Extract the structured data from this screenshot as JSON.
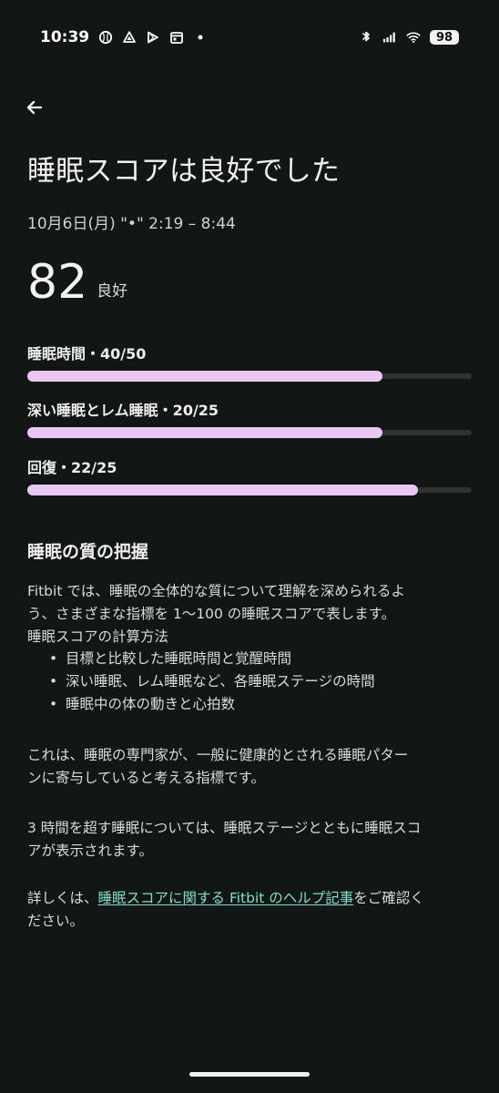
{
  "status_bar": {
    "time": "10:39",
    "battery": "98",
    "left_icons": [
      "baseball-icon",
      "triangle-app-icon",
      "play-store-icon",
      "calendar-icon",
      "dot-indicator-icon"
    ],
    "right_icons": [
      "bluetooth-icon",
      "signal-icon",
      "wifi-icon",
      "battery-icon"
    ]
  },
  "page": {
    "title": "睡眠スコアは良好でした",
    "date": "10月6日(月) \"•\" 2:19 – 8:44",
    "score_value": "82",
    "score_label": "良好"
  },
  "metrics": [
    {
      "label": "睡眠時間・40/50",
      "fill_fraction": 0.8
    },
    {
      "label": "深い睡眠とレム睡眠・20/25",
      "fill_fraction": 0.8
    },
    {
      "label": "回復・22/25",
      "fill_fraction": 0.88
    }
  ],
  "content": {
    "section_title": "睡眠の質の把握",
    "intro_line_1": "Fitbit では、睡眠の全体的な質について理解を深められるよ",
    "intro_line_2": "う、さまざまな指標を 1〜100 の睡眠スコアで表します。",
    "calc_heading": "睡眠スコアの計算方法",
    "bullets": [
      "目標と比較した睡眠時間と覚醒時間",
      "深い睡眠、レム睡眠など、各睡眠ステージの時間",
      "睡眠中の体の動きと心拍数"
    ],
    "expert_line_1": "これは、睡眠の専門家が、一般に健康的とされる睡眠パター",
    "expert_line_2": "ンに寄与していると考える指標です。",
    "hours_line_1": "3 時間を超す睡眠については、睡眠ステージとともに睡眠スコ",
    "hours_line_2": "アが表示されます。",
    "help_prefix": "詳しくは、",
    "help_link": "睡眠スコアに関する Fitbit のヘルプ記事",
    "help_suffix_1": "をご確認く",
    "help_suffix_2": "ださい。"
  }
}
